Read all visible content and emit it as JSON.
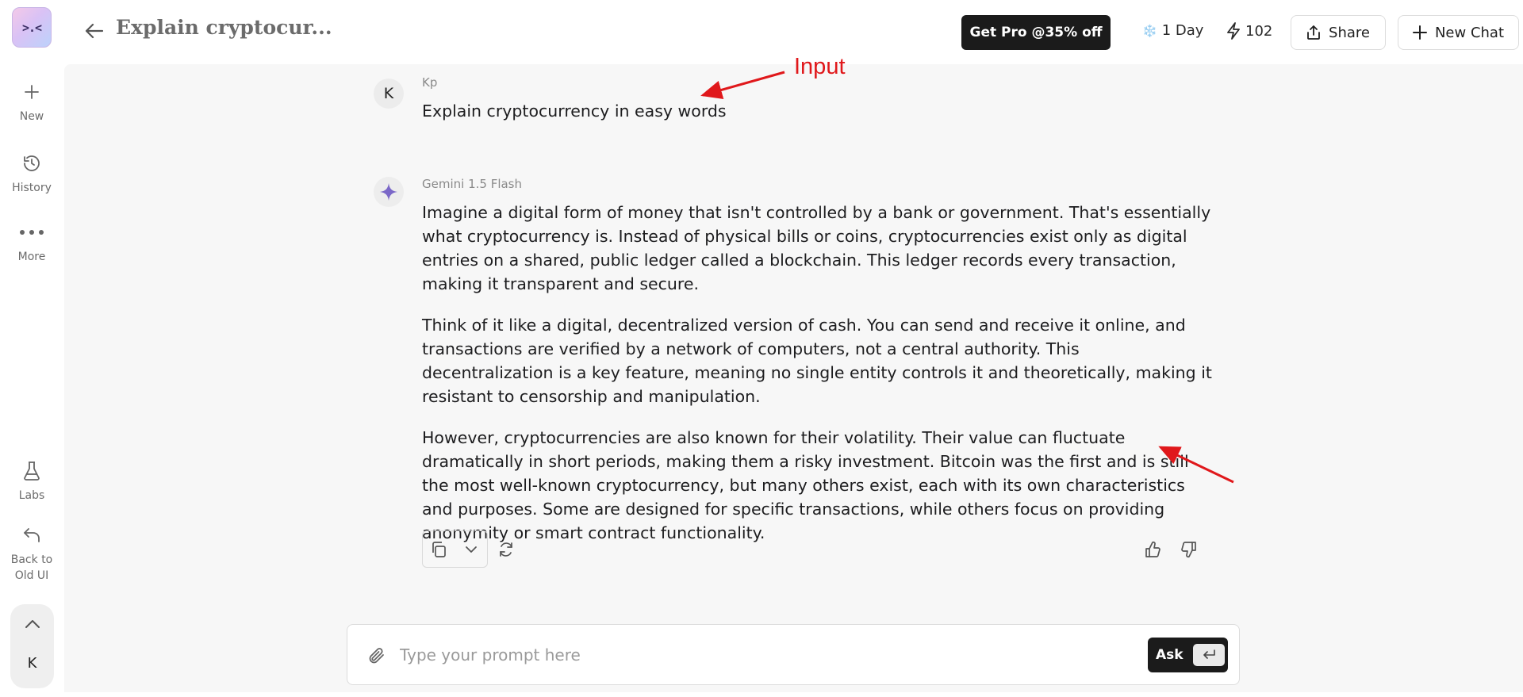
{
  "app": {
    "logo_text": ">.<",
    "chat_title": "Explain cryptocur..."
  },
  "sidebar": {
    "items": [
      {
        "label": "New",
        "icon": "plus-icon"
      },
      {
        "label": "History",
        "icon": "history-icon"
      },
      {
        "label": "More",
        "icon": "more-dots-icon"
      },
      {
        "label": "Labs",
        "icon": "flask-icon"
      },
      {
        "label": "Back to Old UI",
        "icon": "undo-arrow-icon"
      }
    ],
    "account_initial": "K"
  },
  "header": {
    "pro_label": "Get Pro @35% off",
    "streak_icon": "❄️",
    "streak_label": "1 Day",
    "credits_label": "102",
    "share_label": "Share",
    "new_chat_label": "New Chat"
  },
  "conversation": {
    "user": {
      "initial": "K",
      "name": "Kp",
      "text": "Explain cryptocurrency in easy words"
    },
    "bot": {
      "name": "Gemini 1.5 Flash",
      "paragraphs": [
        "Imagine a digital form of money that isn't controlled by a bank or government. That's essentially what cryptocurrency is. Instead of physical bills or coins, cryptocurrencies exist only as digital entries on a shared, public ledger called a blockchain. This ledger records every transaction, making it transparent and secure.",
        "Think of it like a digital, decentralized version of cash. You can send and receive it online, and transactions are verified by a network of computers, not a central authority. This decentralization is a key feature, meaning no single entity controls it and theoretically, making it resistant to censorship and manipulation.",
        "However, cryptocurrencies are also known for their volatility. Their value can fluctuate dramatically in short periods, making them a risky investment. Bitcoin was the first and is still the most well-known cryptocurrency, but many others exist, each with its own characteristics and purposes. Some are designed for specific transactions, while others focus on providing anonymity or smart contract functionality."
      ]
    }
  },
  "annotations": {
    "input_label": "Input",
    "color": "#e0181b"
  },
  "prompt": {
    "placeholder": "Type your prompt here",
    "value": "",
    "ask_label": "Ask"
  },
  "colors": {
    "accent_dark": "#1b1b1b",
    "panel_bg": "#f7f7f7",
    "gemini_star": "#7b68c8"
  }
}
